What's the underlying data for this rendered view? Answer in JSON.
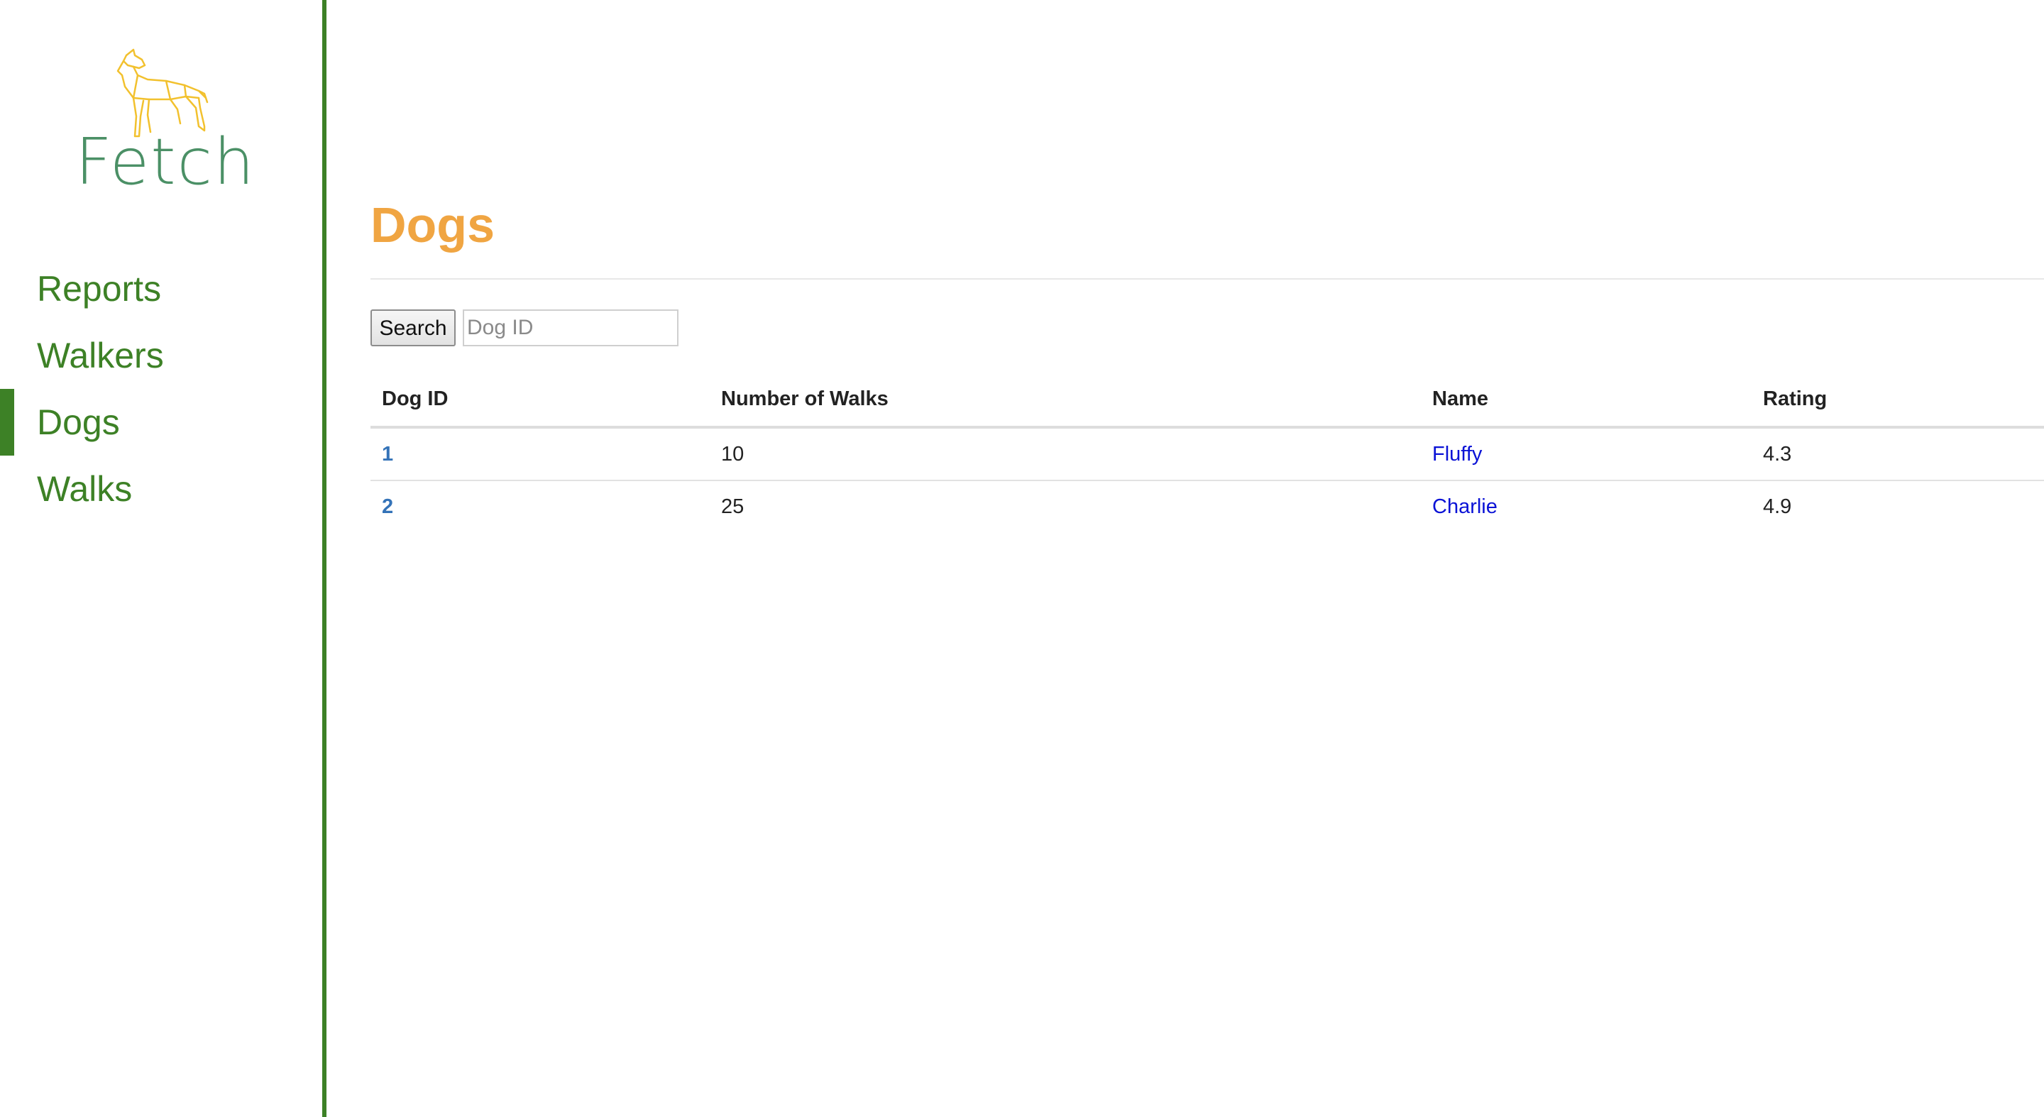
{
  "brand": {
    "logo_text": "Fetch",
    "logo_icon": "dog-outline-icon",
    "logo_color": "#4b9066",
    "dog_color": "#f2c12e"
  },
  "sidebar": {
    "accent_color": "#3d8126",
    "items": [
      {
        "label": "Reports",
        "active": false
      },
      {
        "label": "Walkers",
        "active": false
      },
      {
        "label": "Dogs",
        "active": true
      },
      {
        "label": "Walks",
        "active": false
      }
    ]
  },
  "main": {
    "title": "Dogs",
    "title_color": "#f0a542",
    "search": {
      "button_label": "Search",
      "placeholder": "Dog ID",
      "value": ""
    },
    "table": {
      "columns": [
        "Dog ID",
        "Number of Walks",
        "Name",
        "Rating"
      ],
      "rows": [
        {
          "id": "1",
          "walks": "10",
          "name": "Fluffy",
          "rating": "4.3"
        },
        {
          "id": "2",
          "walks": "25",
          "name": "Charlie",
          "rating": "4.9"
        }
      ]
    }
  }
}
